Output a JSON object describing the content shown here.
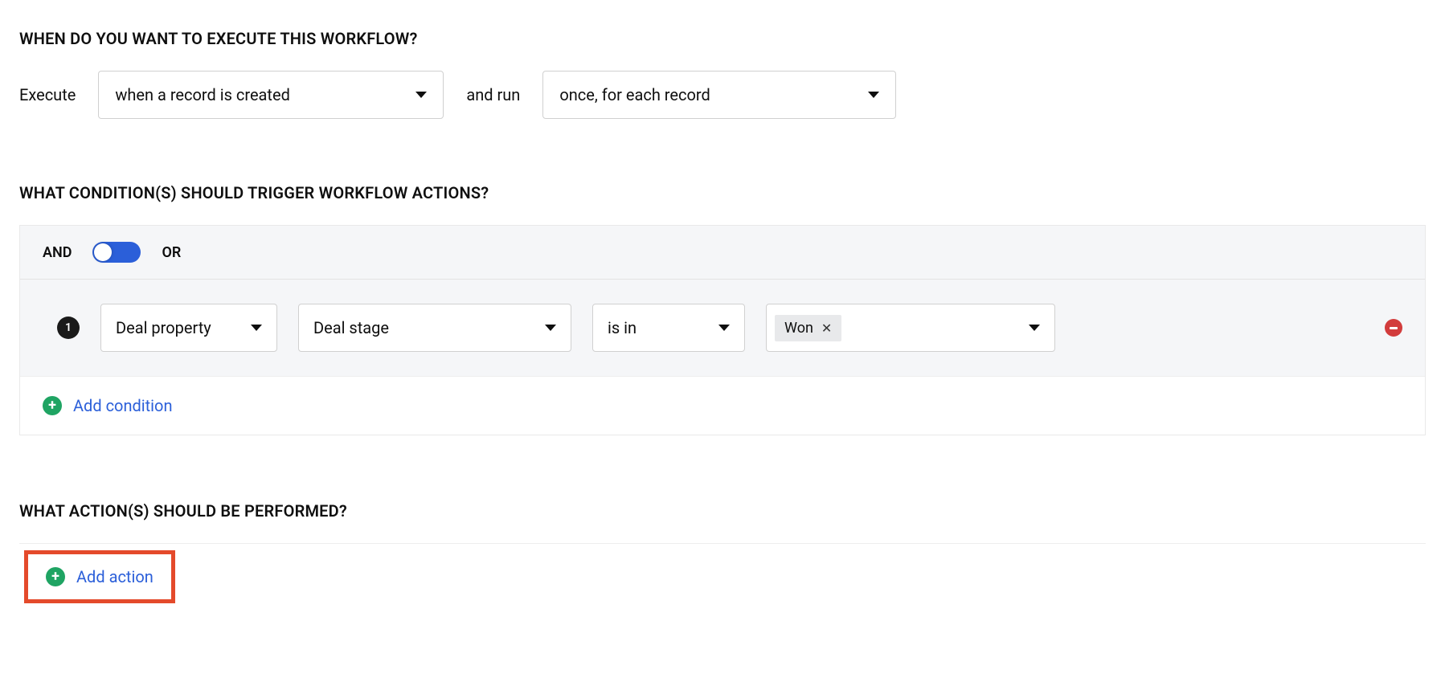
{
  "sections": {
    "execute_heading": "WHEN DO YOU WANT TO EXECUTE THIS WORKFLOW?",
    "conditions_heading": "WHAT CONDITION(S) SHOULD TRIGGER WORKFLOW ACTIONS?",
    "actions_heading": "WHAT ACTION(S) SHOULD BE PERFORMED?"
  },
  "execute": {
    "label": "Execute",
    "trigger_option": "when a record is created",
    "and_run_label": "and run",
    "run_option": "once, for each record"
  },
  "conditions": {
    "logic_and_label": "AND",
    "logic_or_label": "OR",
    "toggle_state": "AND",
    "rows": [
      {
        "index": "1",
        "field": "Deal property",
        "property": "Deal stage",
        "operator": "is in",
        "value_tag": "Won"
      }
    ],
    "add_label": "Add condition"
  },
  "actions": {
    "add_label": "Add action"
  }
}
